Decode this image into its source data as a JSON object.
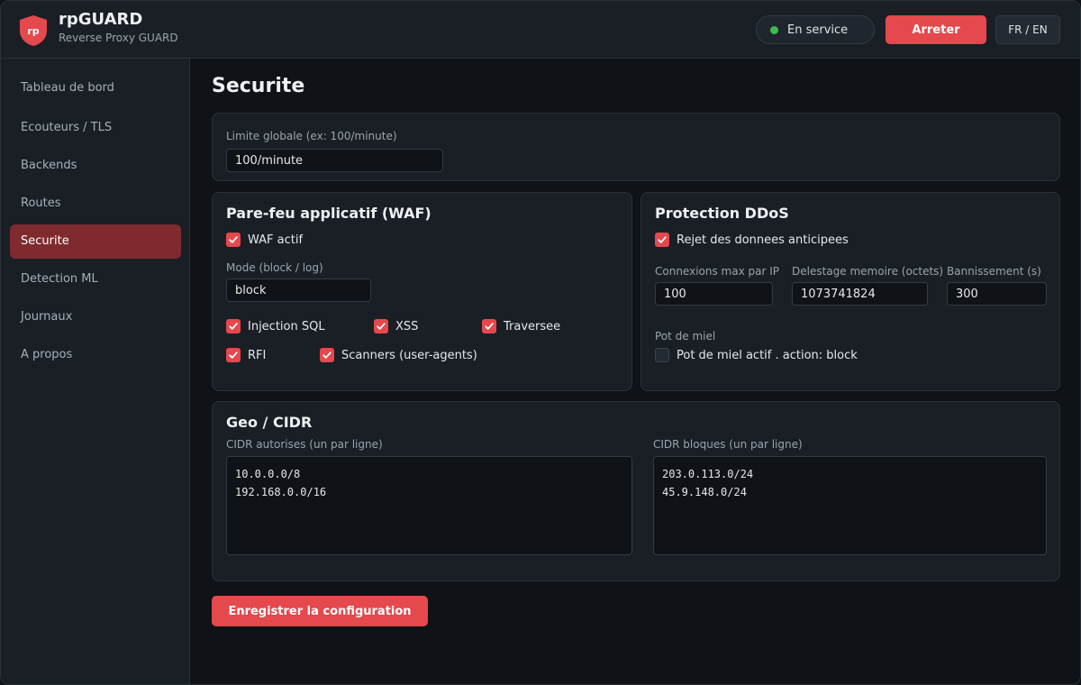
{
  "colors": {
    "accent": "#e5484d",
    "nav_active_bg": "#7f2a2e",
    "status_ok": "#3fb950"
  },
  "brand": {
    "logo_text": "rp",
    "logo_icon": "shield-icon",
    "title": "rpGUARD",
    "subtitle": "Reverse Proxy GUARD"
  },
  "header": {
    "status_text": "En service",
    "stop_label": "Arreter",
    "lang_label": "FR / EN"
  },
  "sidebar": {
    "items": [
      {
        "label": "Tableau de bord",
        "active": false
      },
      {
        "label": "Ecouteurs / TLS",
        "active": false
      },
      {
        "label": "Backends",
        "active": false
      },
      {
        "label": "Routes",
        "active": false
      },
      {
        "label": "Securite",
        "active": true
      },
      {
        "label": "Detection ML",
        "active": false
      },
      {
        "label": "Journaux",
        "active": false
      },
      {
        "label": "A propos",
        "active": false
      }
    ]
  },
  "page": {
    "title": "Securite"
  },
  "rate_limit": {
    "label": "Limite globale (ex: 100/minute)",
    "value": "100/minute"
  },
  "waf": {
    "title": "Pare-feu applicatif (WAF)",
    "enabled": {
      "label": "WAF actif",
      "checked": true
    },
    "mode_label": "Mode (block / log)",
    "mode_value": "block",
    "rules": [
      {
        "label": "Injection SQL",
        "checked": true
      },
      {
        "label": "XSS",
        "checked": true
      },
      {
        "label": "Traversee",
        "checked": true
      },
      {
        "label": "RFI",
        "checked": true
      },
      {
        "label": "Scanners (user-agents)",
        "checked": true
      }
    ]
  },
  "ddos": {
    "title": "Protection DDoS",
    "early_data": {
      "label": "Rejet des donnees anticipees",
      "checked": true
    },
    "max_conn_label": "Connexions max par IP",
    "max_conn_value": "100",
    "mem_label": "Delestage memoire (octets)",
    "mem_value": "1073741824",
    "ban_label": "Bannissement (s)",
    "ban_value": "300",
    "honeypot_label": "Pot de miel",
    "honeypot": {
      "label": "Pot de miel actif . action: block",
      "checked": false
    }
  },
  "geo": {
    "title": "Geo / CIDR",
    "allowed_label": "CIDR autorises (un par ligne)",
    "allowed_value": "10.0.0.0/8\n192.168.0.0/16",
    "blocked_label": "CIDR bloques (un par ligne)",
    "blocked_value": "203.0.113.0/24\n45.9.148.0/24"
  },
  "actions": {
    "save_label": "Enregistrer la configuration"
  }
}
